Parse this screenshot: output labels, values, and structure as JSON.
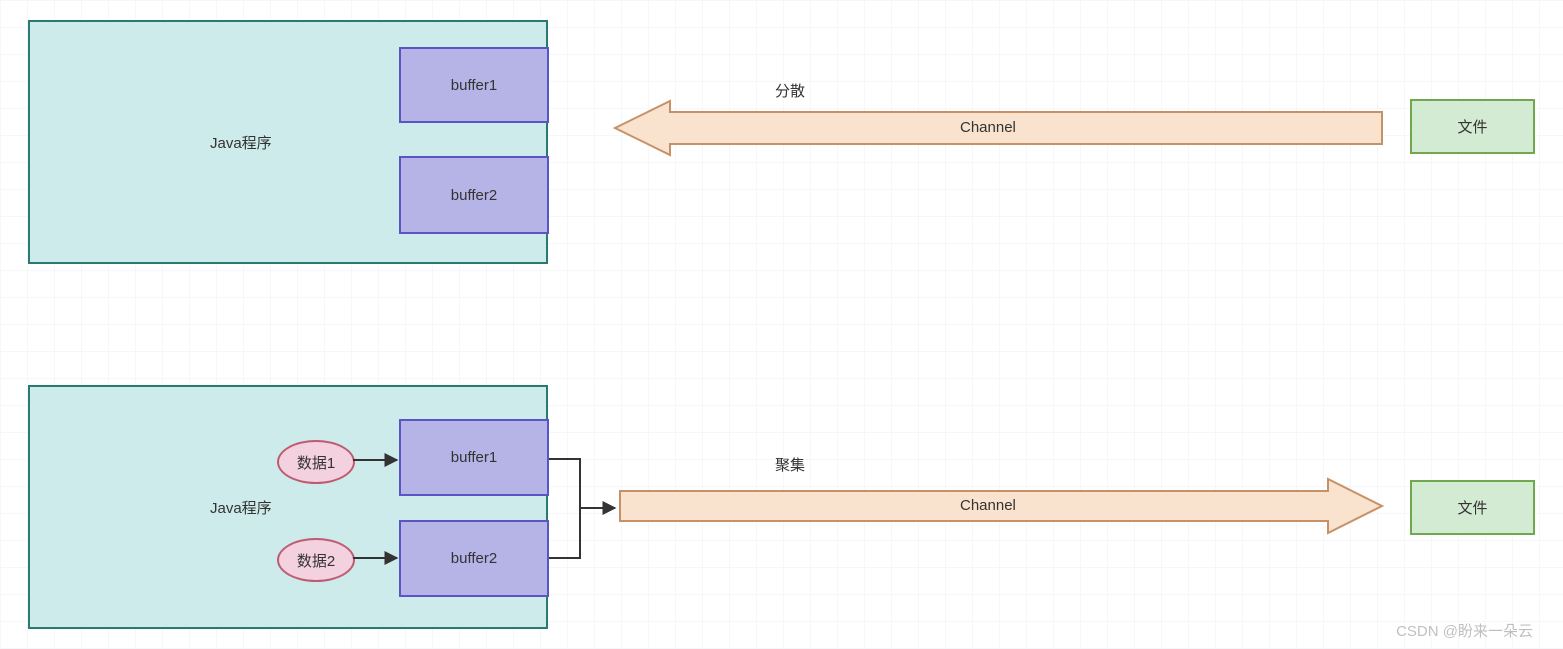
{
  "colors": {
    "java_border": "#2b7a72",
    "java_fill": "#cdebea",
    "buffer_border": "#5a55c4",
    "buffer_fill": "#b6b3e6",
    "file_border": "#6fa84f",
    "file_fill": "#d3ead3",
    "data_border": "#c05a72",
    "data_fill": "#f4d1de",
    "arrow_border": "#c79168",
    "arrow_fill": "#f9e3ce"
  },
  "top": {
    "java_label": "Java程序",
    "buffer1": "buffer1",
    "buffer2": "buffer2",
    "channel": "Channel",
    "scatter_label": "分散",
    "file": "文件"
  },
  "bottom": {
    "java_label": "Java程序",
    "buffer1": "buffer1",
    "buffer2": "buffer2",
    "data1": "数据1",
    "data2": "数据2",
    "channel": "Channel",
    "gather_label": "聚集",
    "file": "文件"
  },
  "watermark": "CSDN @盼来一朵云"
}
